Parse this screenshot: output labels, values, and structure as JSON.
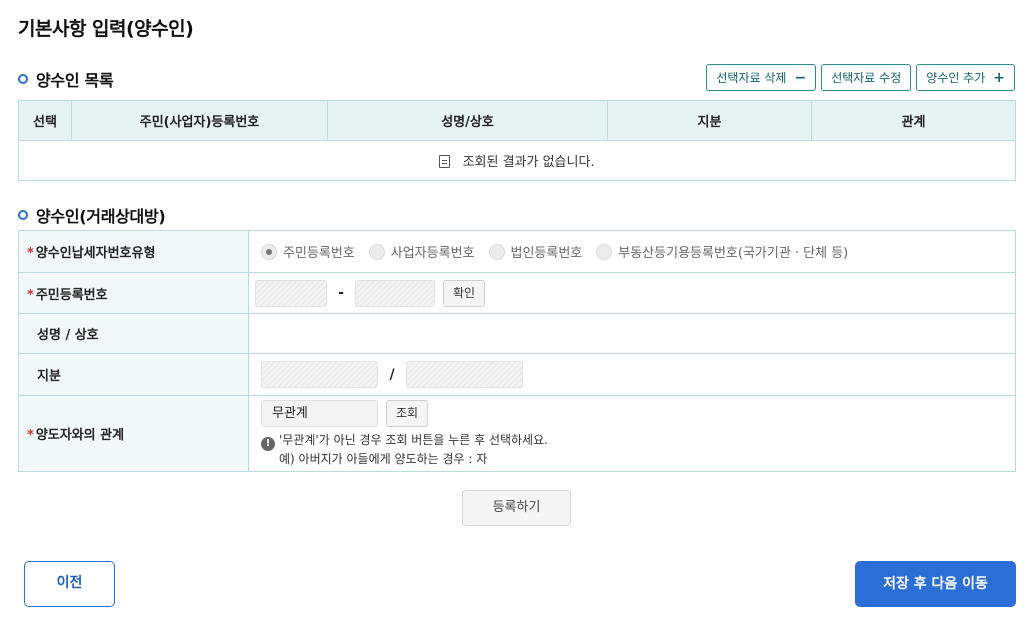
{
  "page_title": "기본사항 입력(양수인)",
  "list_section": {
    "title": "양수인 목록",
    "actions": {
      "delete_label": "선택자료 삭제",
      "delete_symbol": "−",
      "edit_label": "선택자료 수정",
      "add_label": "양수인 추가",
      "add_symbol": "+"
    },
    "columns": [
      "선택",
      "주민(사업자)등록번호",
      "성명/상호",
      "지분",
      "관계"
    ],
    "empty_message": "조회된 결과가 없습니다."
  },
  "form_section": {
    "title": "양수인(거래상대방)",
    "id_type": {
      "label": "양수인납세자번호유형",
      "options": [
        "주민등록번호",
        "사업자등록번호",
        "법인등록번호",
        "부동산등기용등록번호(국가기관 · 단체 등)"
      ],
      "selected": "주민등록번호"
    },
    "resident_no": {
      "label": "주민등록번호",
      "separator": "-",
      "confirm_label": "확인"
    },
    "name": {
      "label": "성명 / 상호"
    },
    "share": {
      "label": "지분",
      "separator": "/"
    },
    "relation": {
      "label": "양도자와의 관계",
      "value": "무관계",
      "lookup_label": "조회",
      "notice_line1": "'무관계'가 아닌 경우 조회 버튼을 누른 후 선택하세요.",
      "notice_line2": "예) 아버지가 아들에게 양도하는 경우 : 자"
    }
  },
  "register_label": "등록하기",
  "prev_label": "이전",
  "next_label": "저장 후 다음 이동",
  "colors": {
    "accent": "#2b6fd6",
    "teal": "#2a8c8c",
    "header_bg": "#e6f3f3",
    "required": "#d32f2f"
  }
}
